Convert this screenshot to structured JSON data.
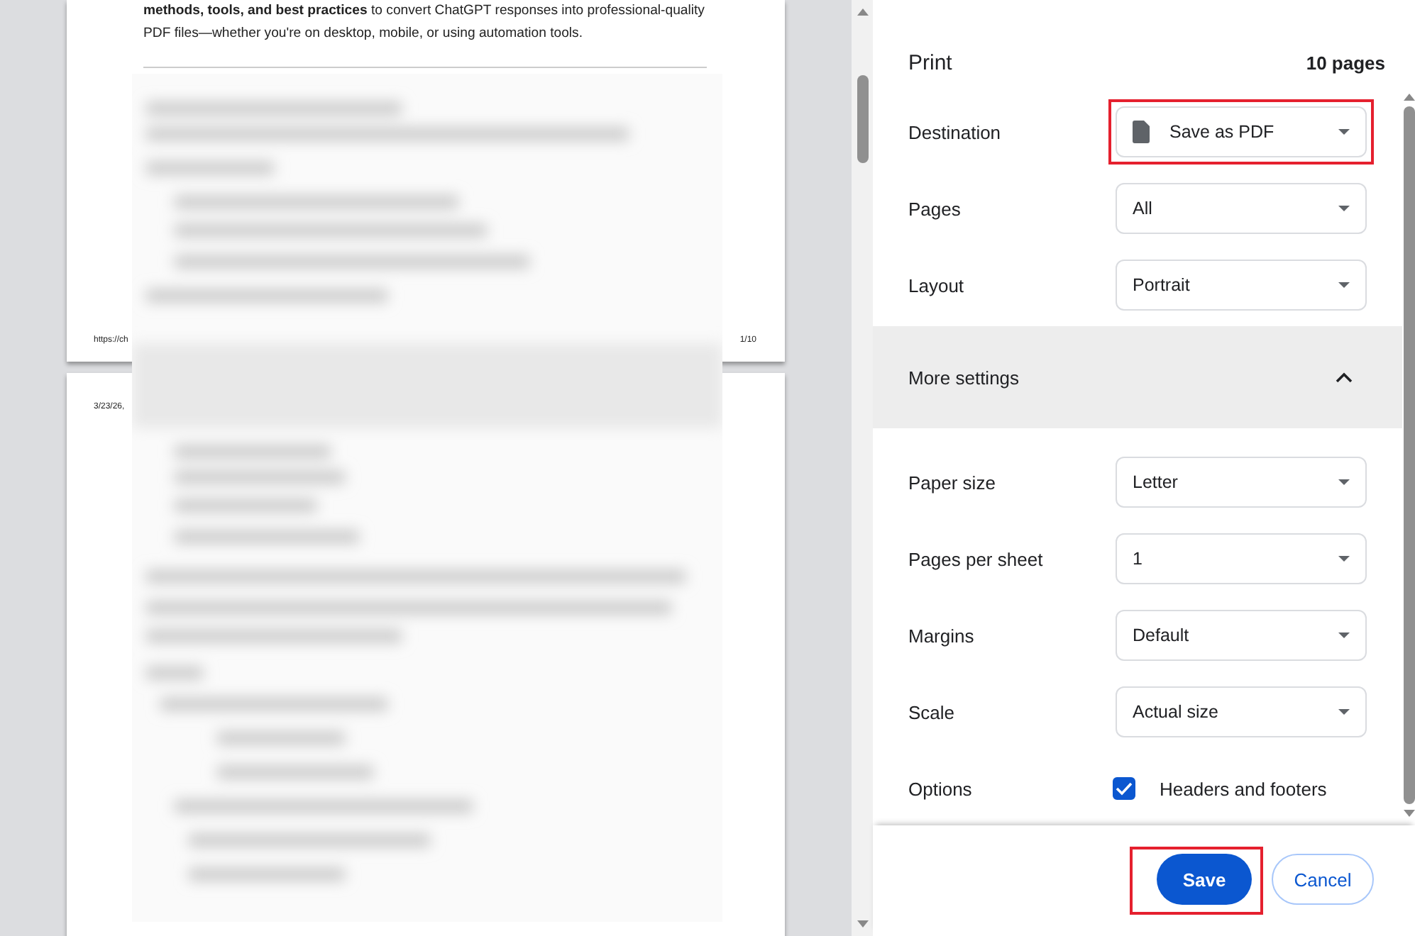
{
  "preview": {
    "intro": "**methods, tools, and best practices** to convert ChatGPT responses into professional-quality PDF files—whether you're on desktop, mobile, or using automation tools.",
    "pages": [
      {
        "footer_left": "https://ch",
        "footer_right": "1/10"
      },
      {
        "header_left": "3/23/26,"
      }
    ]
  },
  "print": {
    "title": "Print",
    "page_count": "10 pages",
    "settings": [
      {
        "kind": "file-select",
        "label": "Destination",
        "value": "Save as PDF",
        "highlighted": true
      },
      {
        "kind": "select",
        "label": "Pages",
        "value": "All",
        "highlighted": false
      },
      {
        "kind": "select",
        "label": "Layout",
        "value": "Portrait",
        "highlighted": false
      }
    ],
    "more_settings": {
      "label": "More settings",
      "expanded": true
    },
    "more": [
      {
        "kind": "select",
        "label": "Paper size",
        "value": "Letter"
      },
      {
        "kind": "select",
        "label": "Pages per sheet",
        "value": "1"
      },
      {
        "kind": "select",
        "label": "Margins",
        "value": "Default"
      },
      {
        "kind": "select",
        "label": "Scale",
        "value": "Actual size"
      },
      {
        "kind": "checkbox",
        "label": "Options",
        "value": "Headers and footers",
        "checked": true
      }
    ],
    "buttons": [
      {
        "label": "Save",
        "kind": "primary",
        "highlighted": true
      },
      {
        "label": "Cancel",
        "kind": "secondary",
        "highlighted": false
      }
    ]
  }
}
